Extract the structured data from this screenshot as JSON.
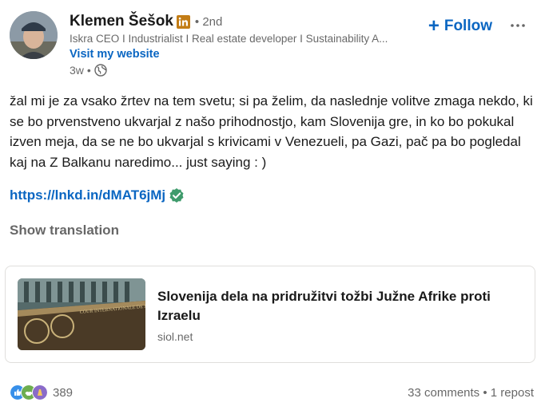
{
  "author": {
    "name": "Klemen Šešok",
    "degree": "• 2nd",
    "headline": "Iskra CEO I Industrialist I Real estate developer I Sustainability A...",
    "website_label": "Visit my website",
    "time": "3w",
    "separator": "•"
  },
  "follow_label": "Follow",
  "post_text": "žal mi je za vsako žrtev na tem svetu; si pa želim, da naslednje volitve zmaga nekdo, ki se bo prvenstveno ukvarjal z našo prihodnostjo, kam Slovenija gre, in ko bo pokukal izven meja, da se ne bo ukvarjal s krivicami v Venezueli, pa Gazi, pač pa bo pogledal kaj na Z Balkanu naredimo... just saying : )",
  "link_text": "https://lnkd.in/dMAT6jMj",
  "show_translation": "Show translation",
  "article": {
    "title": "Slovenija dela na pridružitvi tožbi Južne Afrike proti Izraelu",
    "source": "siol.net",
    "thumb_text": "COUR INTERNATIONALE DE JUSTICE"
  },
  "social": {
    "reactions_count": "389",
    "comments": "33 comments",
    "separator": "•",
    "reposts": "1 repost"
  },
  "icons": {
    "brand_badge": "linkedin-badge-icon",
    "visibility": "globe-icon",
    "more": "more-horizontal-icon",
    "verified": "verified-check-icon",
    "reactions": [
      "like-icon",
      "support-icon",
      "celebrate-icon"
    ]
  },
  "colors": {
    "accent": "#0a66c2",
    "badge": "#c37d16",
    "verified": "#3f9b6c"
  }
}
